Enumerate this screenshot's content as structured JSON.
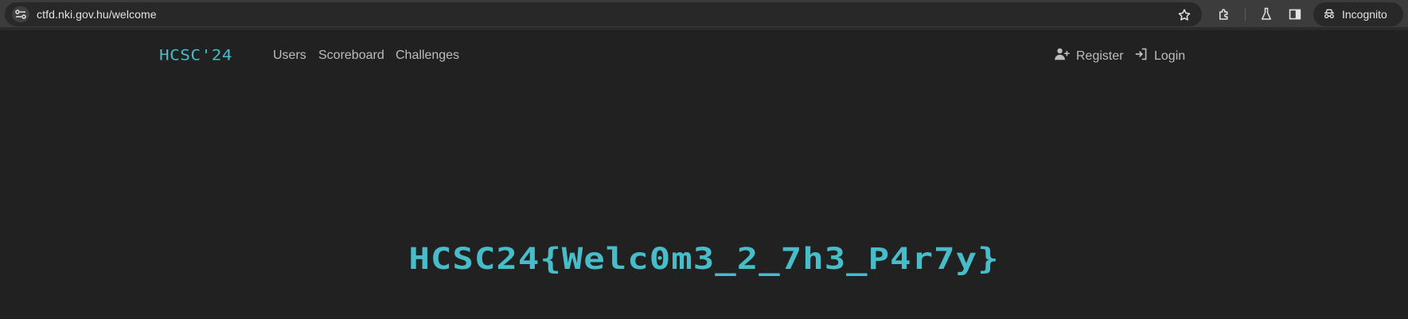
{
  "browser": {
    "url": "ctfd.nki.gov.hu/welcome",
    "incognito_label": "Incognito",
    "icons": [
      "site-info-icon",
      "bookmark-star-icon",
      "extensions-icon",
      "labs-flask-icon",
      "side-panel-icon",
      "incognito-icon"
    ]
  },
  "nav": {
    "brand": "HCSC'24",
    "links": [
      "Users",
      "Scoreboard",
      "Challenges"
    ],
    "register": "Register",
    "login": "Login"
  },
  "main": {
    "flag_text": "HCSC24{Welc0m3_2_7h3_P4r7y}"
  },
  "colors": {
    "accent": "#46bdc9",
    "background": "#212121",
    "nav_text": "#bdbdbd"
  }
}
